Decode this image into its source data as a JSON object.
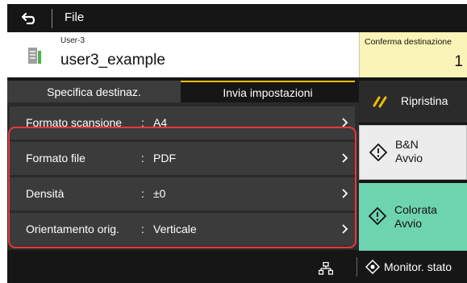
{
  "header": {
    "back_icon": "back-arrow-icon",
    "title": "File"
  },
  "user": {
    "icon": "file-user-icon",
    "small_label": "User-3",
    "name": "user3_example"
  },
  "destination": {
    "label": "Conferma destinazione",
    "count": "1",
    "color": "#fbf4b8"
  },
  "tabs": [
    {
      "label": "Specifica destinaz.",
      "selected": false
    },
    {
      "label": "Invia impostazioni",
      "selected": true
    }
  ],
  "settings": [
    {
      "label": "Formato scansione",
      "value": "A4"
    },
    {
      "label": "Formato file",
      "value": "PDF"
    },
    {
      "label": "Densità",
      "value": "±0"
    },
    {
      "label": "Orientamento orig.",
      "value": "Verticale"
    }
  ],
  "settings_separator": ":",
  "side_buttons": {
    "reset": {
      "label": "Ripristina",
      "icon": "reset-icon"
    },
    "bw_start": {
      "line1": "B&N",
      "line2": "Avvio",
      "icon": "start-icon",
      "color": "#ececec"
    },
    "color_start": {
      "line1": "Colorata",
      "line2": "Avvio",
      "icon": "start-icon",
      "color": "#6ed4b0"
    }
  },
  "footer": {
    "network_icon": "network-icon",
    "monitor_label": "Monitor. stato",
    "monitor_icon": "monitor-status-icon"
  },
  "accent_colors": {
    "highlight": "#e8383d",
    "tab_indicator": "#f0c000"
  }
}
